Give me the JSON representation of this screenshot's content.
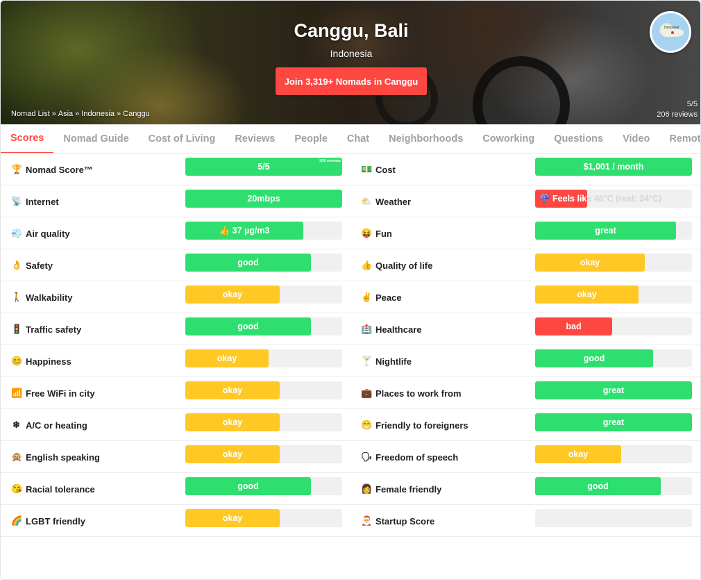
{
  "hero": {
    "city": "Canggu, Bali",
    "country": "Indonesia",
    "join_button": "Join 3,319+ Nomads in Canggu",
    "breadcrumb": [
      "Nomad List",
      "Asia",
      "Indonesia",
      "Canggu"
    ],
    "breadcrumb_sep": "»",
    "rating": "5/5",
    "reviews": "206 reviews",
    "minimap_label": "Denpasar"
  },
  "tabs": [
    {
      "label": "Scores",
      "active": true
    },
    {
      "label": "Nomad Guide"
    },
    {
      "label": "Cost of Living"
    },
    {
      "label": "Reviews"
    },
    {
      "label": "People"
    },
    {
      "label": "Chat"
    },
    {
      "label": "Neighborhoods"
    },
    {
      "label": "Coworking"
    },
    {
      "label": "Questions"
    },
    {
      "label": "Video"
    },
    {
      "label": "Remote"
    }
  ],
  "colors": {
    "green": "#2edf6f",
    "yellow": "#ffc825",
    "red": "#ff4742",
    "track": "#f0f0f0",
    "accent": "#ff4742"
  },
  "scores": [
    {
      "left": {
        "icon": "🏆",
        "icon_name": "trophy-icon",
        "label": "Nomad Score™",
        "value": "5/5",
        "fill": 1.0,
        "color": "green",
        "note": "206 reviews"
      },
      "right": {
        "icon": "💵",
        "icon_name": "money-icon",
        "label": "Cost",
        "value": "$1,001 / month",
        "fill": 1.0,
        "color": "green"
      }
    },
    {
      "left": {
        "icon": "📡",
        "icon_name": "satellite-icon",
        "label": "Internet",
        "value": "20mbps",
        "fill": 1.0,
        "color": "green"
      },
      "right": {
        "icon": "⛅",
        "icon_name": "weather-icon",
        "label": "Weather",
        "value": "☔ Feels like 46°C (real: 34°C)",
        "fill": 0.33,
        "color": "red",
        "partial_text": true
      }
    },
    {
      "left": {
        "icon": "💨",
        "icon_name": "air-icon",
        "label": "Air quality",
        "value": "👍 37 µg/m3",
        "fill": 0.75,
        "color": "green"
      },
      "right": {
        "icon": "😝",
        "icon_name": "fun-icon",
        "label": "Fun",
        "value": "great",
        "fill": 0.9,
        "color": "green"
      }
    },
    {
      "left": {
        "icon": "👌",
        "icon_name": "ok-hand-icon",
        "label": "Safety",
        "value": "good",
        "fill": 0.8,
        "color": "green"
      },
      "right": {
        "icon": "👍",
        "icon_name": "thumbs-up-icon",
        "label": "Quality of life",
        "value": "okay",
        "fill": 0.7,
        "color": "yellow"
      }
    },
    {
      "left": {
        "icon": "🚶",
        "icon_name": "walking-icon",
        "label": "Walkability",
        "value": "okay",
        "fill": 0.6,
        "color": "yellow"
      },
      "right": {
        "icon": "✌",
        "icon_name": "peace-icon",
        "label": "Peace",
        "value": "okay",
        "fill": 0.66,
        "color": "yellow"
      }
    },
    {
      "left": {
        "icon": "🚦",
        "icon_name": "traffic-light-icon",
        "label": "Traffic safety",
        "value": "good",
        "fill": 0.8,
        "color": "green"
      },
      "right": {
        "icon": "🏥",
        "icon_name": "hospital-icon",
        "label": "Healthcare",
        "value": "bad",
        "fill": 0.49,
        "color": "red"
      }
    },
    {
      "left": {
        "icon": "😊",
        "icon_name": "smile-icon",
        "label": "Happiness",
        "value": "okay",
        "fill": 0.53,
        "color": "yellow"
      },
      "right": {
        "icon": "🍸",
        "icon_name": "cocktail-icon",
        "label": "Nightlife",
        "value": "good",
        "fill": 0.75,
        "color": "green"
      }
    },
    {
      "left": {
        "icon": "📶",
        "icon_name": "wifi-icon",
        "label": "Free WiFi in city",
        "value": "okay",
        "fill": 0.6,
        "color": "yellow"
      },
      "right": {
        "icon": "💼",
        "icon_name": "work-icon",
        "label": "Places to work from",
        "value": "great",
        "fill": 1.0,
        "color": "green"
      }
    },
    {
      "left": {
        "icon": "❄",
        "icon_name": "snowflake-icon",
        "label": "A/C or heating",
        "value": "okay",
        "fill": 0.6,
        "color": "yellow"
      },
      "right": {
        "icon": "😁",
        "icon_name": "grin-icon",
        "label": "Friendly to foreigners",
        "value": "great",
        "fill": 1.0,
        "color": "green"
      }
    },
    {
      "left": {
        "icon": "🙊",
        "icon_name": "monkey-icon",
        "label": "English speaking",
        "value": "okay",
        "fill": 0.6,
        "color": "yellow"
      },
      "right": {
        "icon": "🗣",
        "icon_name": "speech-icon",
        "label": "Freedom of speech",
        "value": "okay",
        "fill": 0.55,
        "color": "yellow"
      }
    },
    {
      "left": {
        "icon": "😘",
        "icon_name": "kiss-icon",
        "label": "Racial tolerance",
        "value": "good",
        "fill": 0.8,
        "color": "green"
      },
      "right": {
        "icon": "👩",
        "icon_name": "woman-icon",
        "label": "Female friendly",
        "value": "good",
        "fill": 0.8,
        "color": "green"
      }
    },
    {
      "left": {
        "icon": "🌈",
        "icon_name": "rainbow-icon",
        "label": "LGBT friendly",
        "value": "okay",
        "fill": 0.6,
        "color": "yellow"
      },
      "right": {
        "icon": "🎅",
        "icon_name": "santa-icon",
        "label": "Startup Score",
        "value": "",
        "fill": 0.0,
        "color": "green"
      }
    }
  ]
}
